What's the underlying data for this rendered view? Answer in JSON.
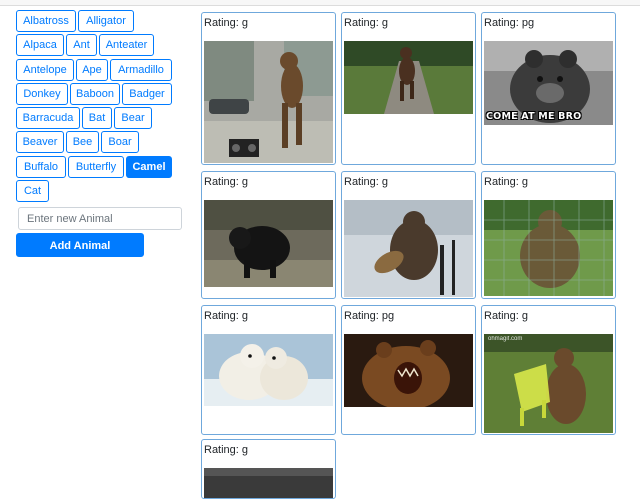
{
  "animals": [
    "Albatross",
    "Alligator",
    "Alpaca",
    "Ant",
    "Anteater",
    "Antelope",
    "Ape",
    "Armadillo",
    "Donkey",
    "Baboon",
    "Badger",
    "Barracuda",
    "Bat",
    "Bear",
    "Beaver",
    "Bee",
    "Boar",
    "Buffalo",
    "Butterfly",
    "Camel",
    "Cat"
  ],
  "active_animal": "Camel",
  "new_animal": {
    "placeholder": "Enter new Animal",
    "value": ""
  },
  "add_button_label": "Add Animal",
  "rating_prefix": "Rating: ",
  "gifs": [
    {
      "rating": "g",
      "scene": "bear-costume-street"
    },
    {
      "rating": "g",
      "scene": "bear-costume-road"
    },
    {
      "rating": "pg",
      "scene": "grizzly-meme",
      "caption": "COME AT ME BRO"
    },
    {
      "rating": "g",
      "scene": "black-bear-forest"
    },
    {
      "rating": "g",
      "scene": "bear-guitar-snow"
    },
    {
      "rating": "g",
      "scene": "bear-fence-field"
    },
    {
      "rating": "g",
      "scene": "polar-bears-hug"
    },
    {
      "rating": "pg",
      "scene": "roaring-brown-bear"
    },
    {
      "rating": "g",
      "scene": "bear-with-chair",
      "watermark": "ohmagif.com"
    },
    {
      "rating": "g",
      "scene": "dark-partial"
    }
  ],
  "colors": {
    "primary": "#007bff",
    "card_border": "#6fa8dc"
  }
}
